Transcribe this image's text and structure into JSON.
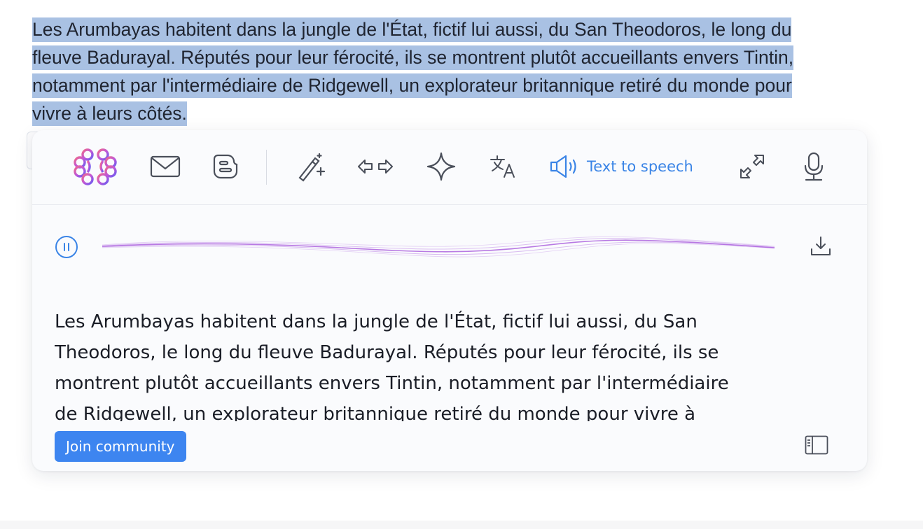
{
  "page": {
    "selected_lines": [
      "Les Arumbayas habitent dans la jungle de l'État, fictif lui aussi, du San Theodoros, le long du",
      "fleuve Badurayal. Réputés pour leur férocité, ils se montrent plutôt accueillants envers Tintin,",
      "notamment par l'intermédiaire de Ridgewell, un explorateur britannique retiré du monde pour",
      "vivre à leurs côtés."
    ],
    "selection_color": "#a9c1e3"
  },
  "toolbar": {
    "items": [
      {
        "name": "brain-logo-icon"
      },
      {
        "name": "mail-icon"
      },
      {
        "name": "blogger-icon"
      },
      {
        "name": "magic-wand-icon"
      },
      {
        "name": "swap-arrows-icon"
      },
      {
        "name": "sparkle-icon"
      },
      {
        "name": "translate-icon"
      },
      {
        "name": "speaker-icon",
        "label": "Text to speech",
        "active": true
      },
      {
        "name": "collapse-arrows-icon"
      },
      {
        "name": "microphone-icon"
      }
    ],
    "accent_color": "#3a84e6"
  },
  "player": {
    "state": "playing",
    "wave_color": "#b06ae0"
  },
  "reading_pane": {
    "lines": [
      "Les Arumbayas habitent dans la jungle de l'État, fictif lui aussi, du San",
      "Theodoros, le long du fleuve Badurayal. Réputés pour leur férocité, ils se",
      "montrent plutôt accueillants envers Tintin, notamment par l'intermédiaire",
      "de Ridgewell, un explorateur britannique retiré du monde pour vivre à"
    ]
  },
  "footer": {
    "join_label": "Join community",
    "join_color": "#3d85f0"
  }
}
